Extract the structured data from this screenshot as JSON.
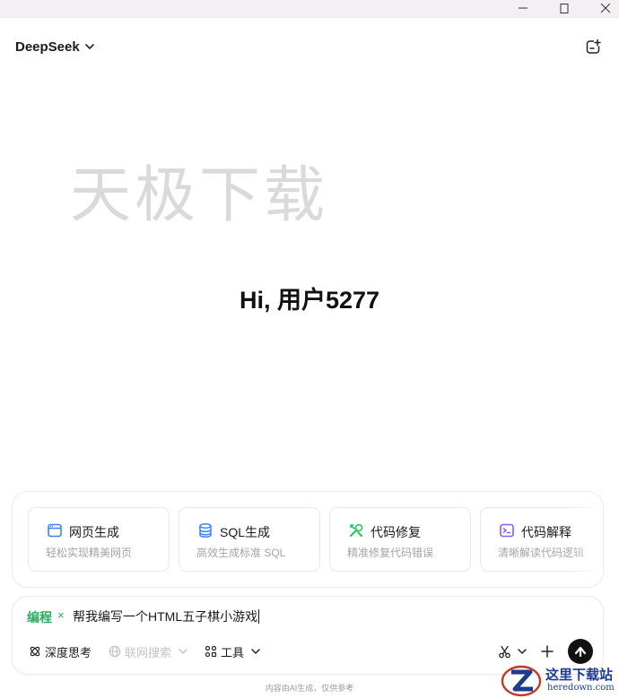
{
  "app": {
    "model_name": "DeepSeek",
    "watermark": "天极下载",
    "greeting": "Hi, 用户5277"
  },
  "window_controls": {
    "minimize_icon": "minimize-icon",
    "maximize_icon": "maximize-icon",
    "close_icon": "close-icon"
  },
  "cards": [
    {
      "title": "网页生成",
      "subtitle": "轻松实现精美网页",
      "icon": "browser-window-icon",
      "color": "#3b82f6"
    },
    {
      "title": "SQL生成",
      "subtitle": "高效生成标准 SQL",
      "icon": "database-icon",
      "color": "#3b82f6"
    },
    {
      "title": "代码修复",
      "subtitle": "精准修复代码错误",
      "icon": "wrench-icon",
      "color": "#22c55e"
    },
    {
      "title": "代码解释",
      "subtitle": "清晰解读代码逻辑",
      "icon": "terminal-icon",
      "color": "#8b5cf6"
    }
  ],
  "input": {
    "tag": "编程",
    "tag_close": "×",
    "value": "帮我编写一个HTML五子棋小游戏"
  },
  "tools": {
    "deep_think": "深度思考",
    "web_search": "联网搜索",
    "tools": "工具"
  },
  "footer": {
    "note": "内容由AI生成，仅供参考"
  },
  "site_logo": {
    "cn": "这里下载站",
    "en": "heredown.com"
  },
  "colors": {
    "accent_green": "#27ae60",
    "send_button": "#111111",
    "titlebar": "#f4eff2"
  }
}
